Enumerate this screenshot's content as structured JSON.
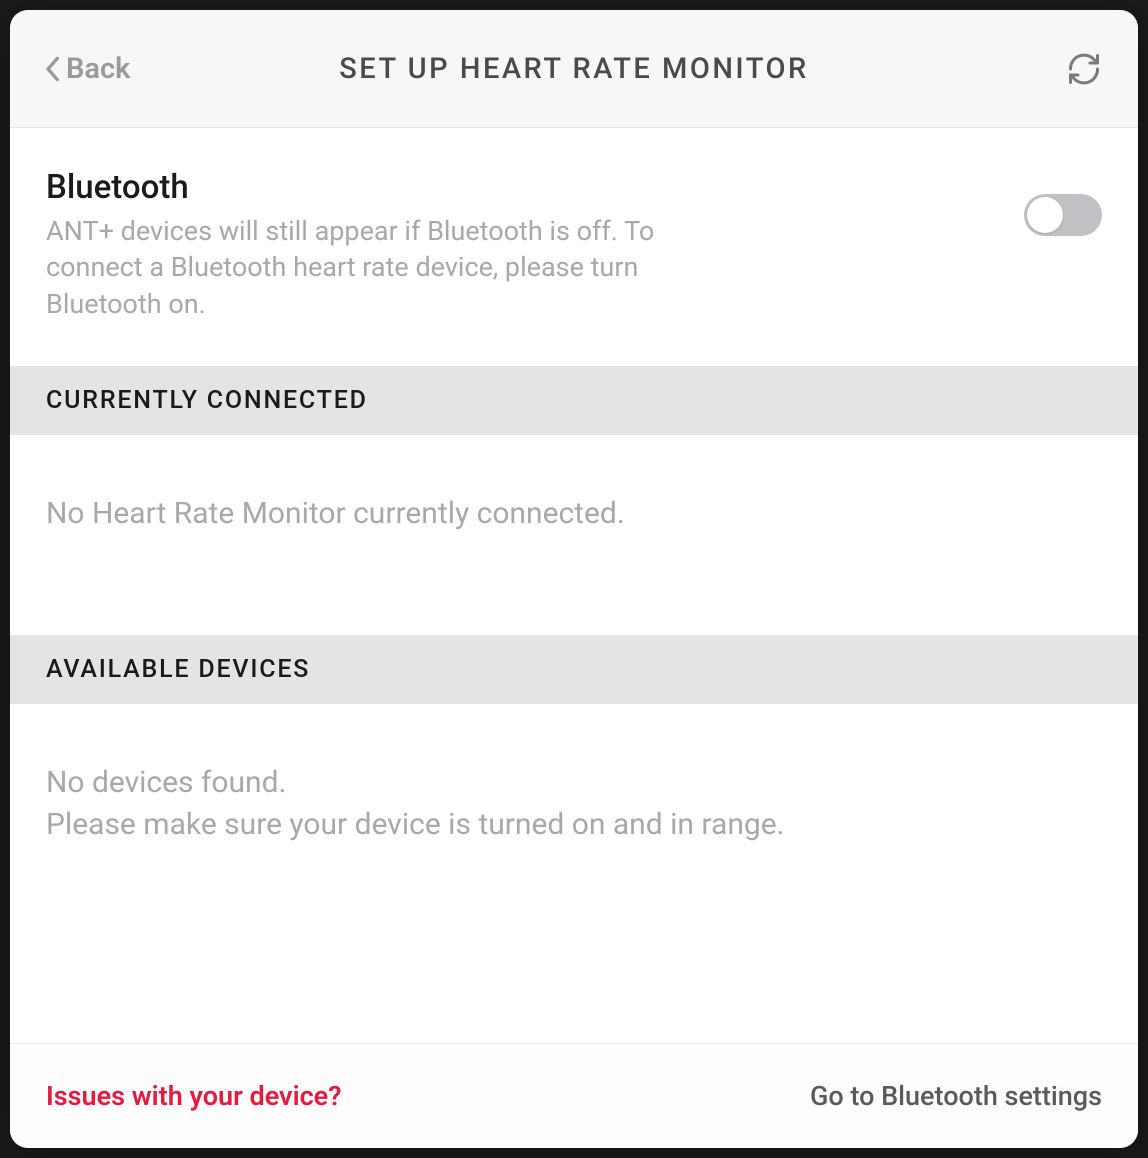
{
  "header": {
    "back_label": "Back",
    "title": "SET UP HEART RATE MONITOR"
  },
  "bluetooth": {
    "title": "Bluetooth",
    "description": "ANT+ devices will still appear if Bluetooth is off. To connect a Bluetooth heart rate device, please turn Bluetooth on.",
    "enabled": false
  },
  "sections": {
    "connected": {
      "heading": "CURRENTLY CONNECTED",
      "empty_text": "No Heart Rate Monitor currently connected."
    },
    "available": {
      "heading": "AVAILABLE DEVICES",
      "empty_line1": "No devices found.",
      "empty_line2": "Please make sure your device is turned on and in range."
    }
  },
  "footer": {
    "issues_link": "Issues with your device?",
    "settings_link": "Go to Bluetooth settings"
  }
}
